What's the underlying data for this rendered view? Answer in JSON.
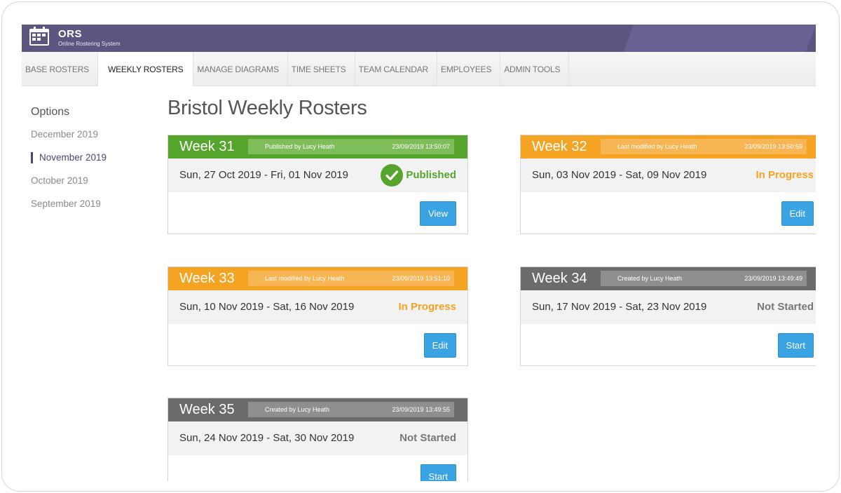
{
  "app": {
    "name": "ORS",
    "subtitle": "Online Rostering System"
  },
  "nav": {
    "tabs": [
      {
        "label": "BASE ROSTERS"
      },
      {
        "label": "WEEKLY ROSTERS",
        "active": true
      },
      {
        "label": "MANAGE DIAGRAMS"
      },
      {
        "label": "TIME SHEETS"
      },
      {
        "label": "TEAM CALENDAR"
      },
      {
        "label": "EMPLOYEES"
      },
      {
        "label": "ADMIN TOOLS"
      }
    ]
  },
  "sidebar": {
    "title": "Options",
    "items": [
      {
        "label": "December 2019"
      },
      {
        "label": "November 2019",
        "active": true
      },
      {
        "label": "October 2019"
      },
      {
        "label": "September 2019"
      }
    ]
  },
  "page": {
    "title": "Bristol Weekly Rosters"
  },
  "rosters": [
    {
      "week": "Week 31",
      "by": "Published by Lucy Heath",
      "timestamp": "23/09/2019 13:50:07",
      "dates": "Sun, 27 Oct 2019 - Fri, 01 Nov 2019",
      "status": "Published",
      "button": "View"
    },
    {
      "week": "Week 32",
      "by": "Last modified by Lucy Heath",
      "timestamp": "23/09/2019 13:50:59",
      "dates": "Sun, 03 Nov 2019 - Sat, 09 Nov 2019",
      "status": "In Progress",
      "button": "Edit"
    },
    {
      "week": "Week 33",
      "by": "Last modified by Lucy Heath",
      "timestamp": "23/09/2019 13:51:10",
      "dates": "Sun, 10 Nov 2019 - Sat, 16 Nov 2019",
      "status": "In Progress",
      "button": "Edit"
    },
    {
      "week": "Week 34",
      "by": "Created by Lucy Heath",
      "timestamp": "23/09/2019 13:49:49",
      "dates": "Sun, 17 Nov 2019 - Sat, 23 Nov 2019",
      "status": "Not Started",
      "button": "Start"
    },
    {
      "week": "Week 35",
      "by": "Created by Lucy Heath",
      "timestamp": "23/09/2019 13:49:55",
      "dates": "Sun, 24 Nov 2019 - Sat, 30 Nov 2019",
      "status": "Not Started",
      "button": "Start"
    }
  ],
  "colors": {
    "published": "#55a52c",
    "in_progress": "#f5a322",
    "not_started": "#6b6b6b",
    "header": "#5b5680",
    "button": "#3aa3e3"
  }
}
